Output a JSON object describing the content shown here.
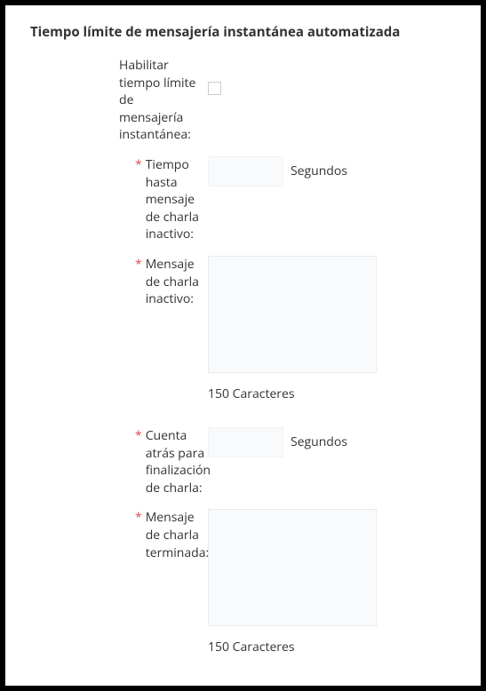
{
  "section": {
    "title": "Tiempo límite de mensajería instantánea automatizada"
  },
  "fields": {
    "enable": {
      "label": "Habilitar tiempo límite de mensajería instantánea:"
    },
    "inactiveTime": {
      "label": "Tiempo hasta mensaje de charla inactivo:",
      "unit": "Segundos",
      "value": ""
    },
    "inactiveMsg": {
      "label": "Mensaje de charla inactivo:",
      "value": "",
      "charCount": "150 Caracteres"
    },
    "countdown": {
      "label": "Cuenta atrás para finalización de charla:",
      "unit": "Segundos",
      "value": ""
    },
    "endedMsg": {
      "label": "Mensaje de charla terminada:",
      "value": "",
      "charCount": "150 Caracteres"
    }
  }
}
